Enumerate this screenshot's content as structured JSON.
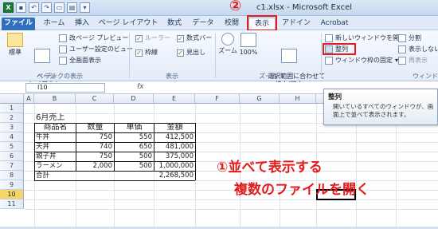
{
  "window": {
    "title": "c1.xlsx - Microsoft Excel"
  },
  "qat": {
    "icons": [
      "excel-icon",
      "save-icon",
      "undo-icon",
      "redo-icon",
      "open-icon",
      "print-icon",
      "dropdown-icon"
    ]
  },
  "tabs": [
    {
      "label": "ファイル"
    },
    {
      "label": "ホーム"
    },
    {
      "label": "挿入"
    },
    {
      "label": "ページ レイアウト"
    },
    {
      "label": "数式"
    },
    {
      "label": "データ"
    },
    {
      "label": "校閲"
    },
    {
      "label": "表示"
    },
    {
      "label": "アドイン"
    },
    {
      "label": "Acrobat"
    }
  ],
  "callout_num2": "②",
  "ribbon": {
    "group_workbook_views": {
      "label": "ブックの表示",
      "normal": "標準",
      "page_layout": "ページ\nレイアウト",
      "page_break": "改ページ プレビュー",
      "custom_view": "ユーザー設定のビュー",
      "fullscreen": "全画面表示"
    },
    "group_show": {
      "label": "表示",
      "ruler": "ルーラー",
      "formula_bar": "数式バー",
      "gridlines": "枠線",
      "headings": "見出し"
    },
    "group_zoom": {
      "label": "ズーム",
      "zoom": "ズーム",
      "zoom100": "100%",
      "zoom_selection": "選択範囲に合わせて\n拡大/縮小"
    },
    "group_window": {
      "label": "ウィンドウ",
      "new_window": "新しいウィンドウを開く",
      "arrange": "整列",
      "freeze": "ウィンドウ枠の固定",
      "split": "分割",
      "hide": "表示しない",
      "unhide": "再表示"
    }
  },
  "formula_bar": {
    "name_box": "I10",
    "fx": "fx",
    "value": ""
  },
  "columns": [
    "A",
    "B",
    "C",
    "D",
    "E",
    "F",
    "G",
    "H",
    "I"
  ],
  "rows": [
    "1",
    "2",
    "3",
    "4",
    "5",
    "6",
    "7",
    "8",
    "9",
    "10",
    "11"
  ],
  "sheet": {
    "title": "6月売上",
    "headers": [
      "商品名",
      "数量",
      "単価",
      "金額"
    ],
    "data": [
      [
        "牛丼",
        "750",
        "550",
        "412,500"
      ],
      [
        "天丼",
        "740",
        "650",
        "481,000"
      ],
      [
        "親子丼",
        "750",
        "500",
        "375,000"
      ],
      [
        "ラーメン",
        "2,000",
        "500",
        "1,000,000"
      ]
    ],
    "total_label": "合計",
    "total_value": "2,268,500"
  },
  "tooltip": {
    "title": "整列",
    "body": "開いているすべてのウィンドウが、画面上で並べて表示されます。"
  },
  "annotation": {
    "line1": "①並べて表示する",
    "line2": "複数のファイルを開く"
  },
  "colors": {
    "annotation_red": "#e41b1b",
    "excel_green": "#1f7a3a",
    "selected_row": "#f7d46a"
  }
}
